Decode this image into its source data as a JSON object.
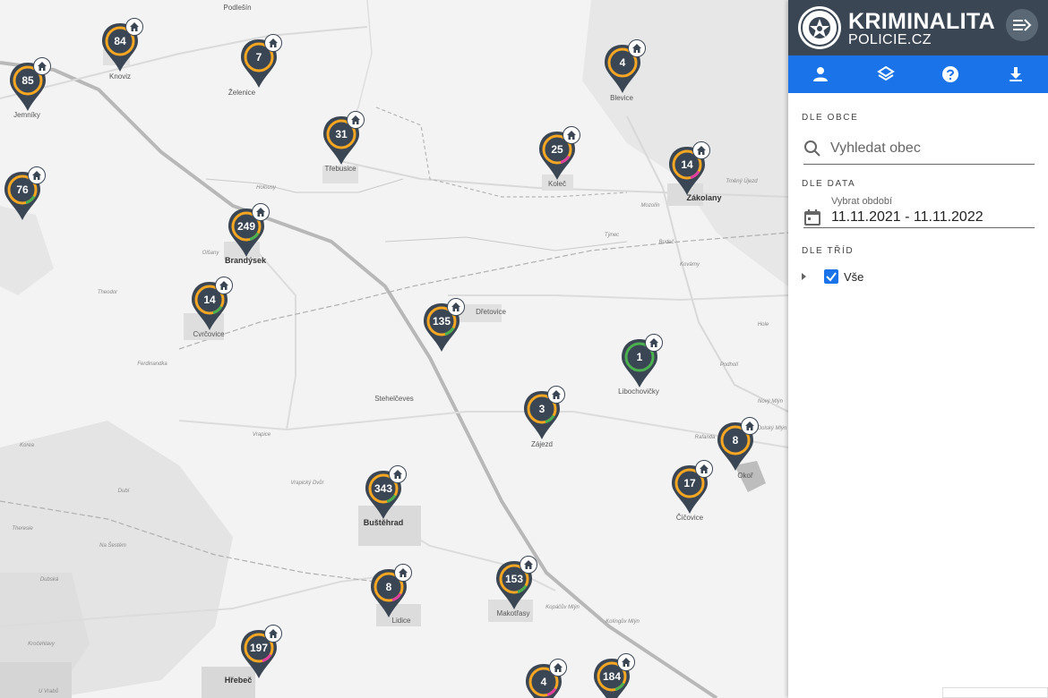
{
  "header": {
    "title": "KRIMINALITA",
    "subtitle": "POLICIE.CZ"
  },
  "toolbar": [
    {
      "name": "person-icon"
    },
    {
      "name": "layers-icon"
    },
    {
      "name": "help-icon"
    },
    {
      "name": "download-icon"
    }
  ],
  "filters": {
    "municipality_label": "DLE OBCE",
    "search_placeholder": "Vyhledat obec",
    "date_label": "DLE DATA",
    "date_caption": "Vybrat období",
    "date_value": "11.11.2021 - 11.11.2022",
    "class_label": "DLE TŘÍD",
    "class_item": "Vše"
  },
  "colors": {
    "header_bg": "#3b4654",
    "toolbar_bg": "#1a73e8",
    "marker_fill": "#3b4654",
    "ring_orange": "#f5a623",
    "ring_green": "#4caf50",
    "ring_magenta": "#e040a0"
  },
  "places": [
    "Podlešín",
    "Knoviz",
    "Želenice",
    "Jemníky",
    "Třebusice",
    "Blevice",
    "Koleč",
    "Zákolany",
    "Trněný Újezd",
    "Brandýsek",
    "Olšany",
    "Theodor",
    "Cvrčovice",
    "Dřetovice",
    "Ferdinandka",
    "Stehelčeves",
    "Libochovičky",
    "Podholí",
    "Hole",
    "Nový Mlýn",
    "Dolský Mlýn",
    "Rafanda",
    "Okoř",
    "Zájezd",
    "Buštěhrad",
    "Čičovice",
    "Korea",
    "Dubí",
    "Theresie",
    "Na Šestém",
    "Lidice",
    "Makotřasy",
    "Hřebeč",
    "Kročehlavy",
    "U Vrabů",
    "Vrapice",
    "Kovárny",
    "Budeč",
    "Týnec",
    "Mozolín",
    "Holousy",
    "Vrapický Dvůr",
    "Dubská",
    "Kolíngův Mlýn",
    "Kopáčův Mlýn"
  ],
  "markers": [
    {
      "count": "84",
      "ring": "orange"
    },
    {
      "count": "7",
      "ring": "orange"
    },
    {
      "count": "85",
      "ring": "orange"
    },
    {
      "count": "31",
      "ring": "orange"
    },
    {
      "count": "4",
      "ring": "orange"
    },
    {
      "count": "25",
      "ring": "orange-magenta"
    },
    {
      "count": "14",
      "ring": "orange-magenta"
    },
    {
      "count": "76",
      "ring": "orange-green"
    },
    {
      "count": "249",
      "ring": "orange-green"
    },
    {
      "count": "14",
      "ring": "orange-green"
    },
    {
      "count": "135",
      "ring": "orange-green"
    },
    {
      "count": "1",
      "ring": "green"
    },
    {
      "count": "3",
      "ring": "orange-green"
    },
    {
      "count": "8",
      "ring": "orange"
    },
    {
      "count": "17",
      "ring": "orange"
    },
    {
      "count": "343",
      "ring": "orange-green"
    },
    {
      "count": "153",
      "ring": "orange-green"
    },
    {
      "count": "8",
      "ring": "orange-magenta"
    },
    {
      "count": "197",
      "ring": "orange-magenta"
    },
    {
      "count": "4",
      "ring": "orange-magenta"
    },
    {
      "count": "184",
      "ring": "orange-green"
    }
  ]
}
